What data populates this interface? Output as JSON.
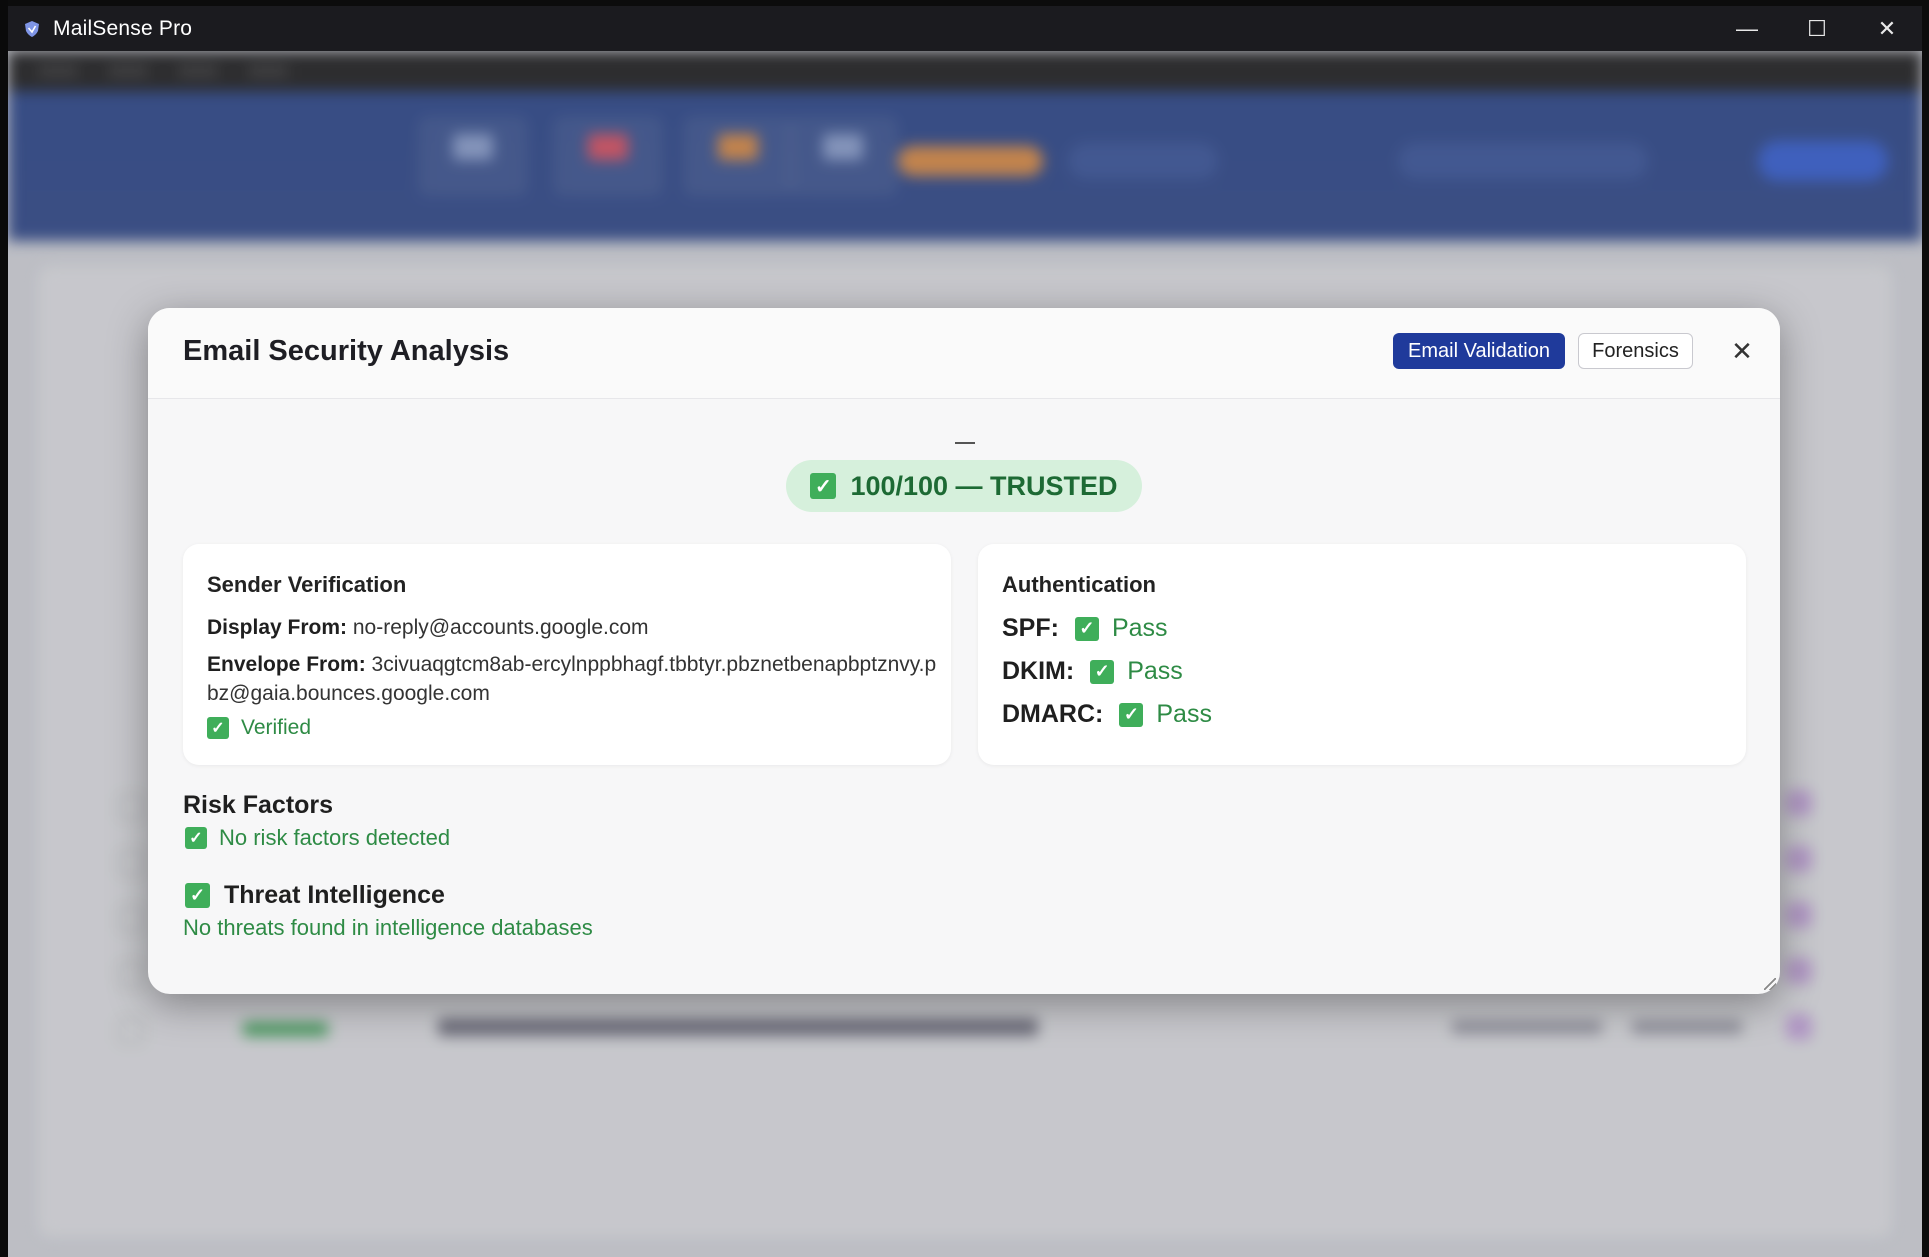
{
  "window": {
    "title": "MailSense Pro",
    "controls": {
      "minimize": "—",
      "maximize": "☐",
      "close": "✕"
    },
    "icon": "shield-icon",
    "accent": "#1f3a9b"
  },
  "modal": {
    "title": "Email Security Analysis",
    "tabs": {
      "active": "Email Validation",
      "inactive": "Forensics"
    },
    "close_label": "✕",
    "score": {
      "label": "100/100 — TRUSTED",
      "value": 100,
      "max": 100,
      "status": "TRUSTED",
      "color": "#2e8b45"
    },
    "sender_verification": {
      "title": "Sender Verification",
      "display_from_key": "Display From:",
      "display_from_value": "no-reply@accounts.google.com",
      "envelope_from_key": "Envelope From:",
      "envelope_from_value": "3civuaqgtcm8ab-ercylnppbhagf.tbbtyr.pbznetbenapbptznvy.pbz@gaia.bounces.google.com",
      "status": "Verified"
    },
    "authentication": {
      "title": "Authentication",
      "checks": [
        {
          "key": "SPF:",
          "result": "Pass"
        },
        {
          "key": "DKIM:",
          "result": "Pass"
        },
        {
          "key": "DMARC:",
          "result": "Pass"
        }
      ]
    },
    "risk_factors": {
      "title": "Risk Factors",
      "message": "No risk factors detected"
    },
    "threat_intelligence": {
      "title": "Threat Intelligence",
      "message": "No threats found in intelligence databases"
    },
    "check_glyph": "✓"
  }
}
